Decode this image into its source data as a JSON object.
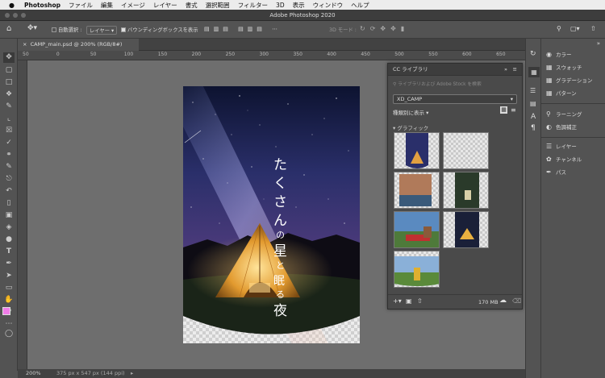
{
  "menubar": {
    "apple": "",
    "app_name": "Photoshop",
    "items": [
      "ファイル",
      "編集",
      "イメージ",
      "レイヤー",
      "書式",
      "選択範囲",
      "フィルター",
      "3D",
      "表示",
      "ウィンドウ",
      "ヘルプ"
    ]
  },
  "window": {
    "title": "Adobe Photoshop 2020"
  },
  "options": {
    "auto_select_label": "自動選択 :",
    "auto_select_value": "レイヤー",
    "bounding_box_label": "バウンディングボックスを表示",
    "mode_3d_label": "3D モード :"
  },
  "document": {
    "tab_label": "CAMP_main.psd @ 200% (RGB/8#)",
    "ruler_ticks": [
      "50",
      "0",
      "50",
      "100",
      "150",
      "200",
      "250",
      "300",
      "350",
      "400",
      "450",
      "500",
      "550",
      "600",
      "650"
    ]
  },
  "poster": {
    "headline_chars": [
      "た",
      "く",
      "さ",
      "ん",
      "の",
      "星",
      "と",
      "眠",
      "る",
      "夜"
    ]
  },
  "status": {
    "zoom": "200%",
    "doc_size": "375 px x 547 px (144 ppi)"
  },
  "cc_library": {
    "tab_label": "CC ライブラリ",
    "search_placeholder": "ライブラリおよび Adobe Stock を検索",
    "library_name": "XD_CAMP",
    "sort_label": "種類別に表示",
    "section_label": "グラフィック",
    "storage": "170 MB"
  },
  "right_panel": {
    "group1": [
      "カラー",
      "スウォッチ",
      "グラデーション",
      "パターン"
    ],
    "group2": [
      "ラーニング",
      "色調補正"
    ],
    "group3": [
      "レイヤー",
      "チャンネル",
      "パス"
    ]
  },
  "colors": {
    "foreground": "#f07ce8",
    "background": "#ffffff"
  }
}
